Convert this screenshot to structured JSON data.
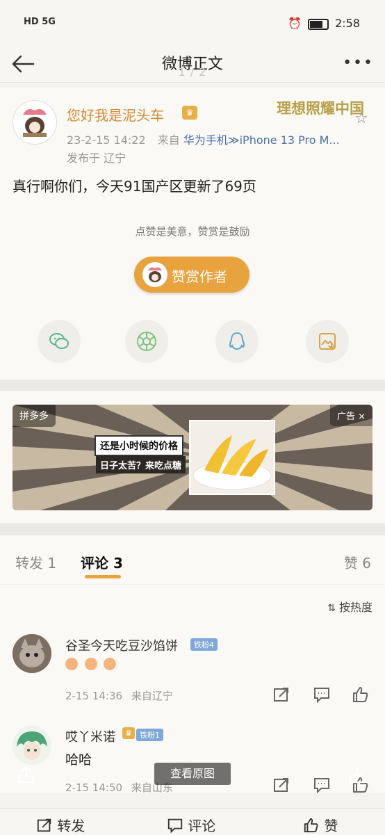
{
  "status": {
    "left": "HD 5G",
    "time": "2:58"
  },
  "nav": {
    "title": "微博正文",
    "page_indicator": "1 / 2",
    "more": "•••"
  },
  "post": {
    "username": "您好我是泥头车",
    "watermark": "理想照耀中国",
    "time": "23-2-15 14:22",
    "source_prefix": "来自",
    "source": "华为手机≫iPhone 13 Pro M...",
    "location": "发布于 辽宁",
    "text": "真行啊你们，今天91国产区更新了69页",
    "reward_note": "点赞是美意，赞赏是鼓励",
    "reward_button": "赞赏作者"
  },
  "ad": {
    "tag": "拼多多",
    "label": "广告 ×",
    "line1": "还是小时候的价格",
    "line2": "日子太苦？来吃点糖"
  },
  "tabs": {
    "repost": "转发 1",
    "comment": "评论 3",
    "like": "赞 6"
  },
  "sort": "按热度",
  "comments": [
    {
      "name": "谷圣今天吃豆沙馅饼",
      "badge": "铁粉4",
      "body": "",
      "time": "2-15 14:36",
      "source": "来自辽宁"
    },
    {
      "name": "哎丫米诺",
      "badge": "铁粉1",
      "body": "哈哈",
      "time": "2-15 14:50",
      "source": "来自山东"
    }
  ],
  "overlay": {
    "view_original": "查看原图"
  },
  "bottom": {
    "repost": "转发",
    "comment": "评论",
    "like": "赞"
  }
}
